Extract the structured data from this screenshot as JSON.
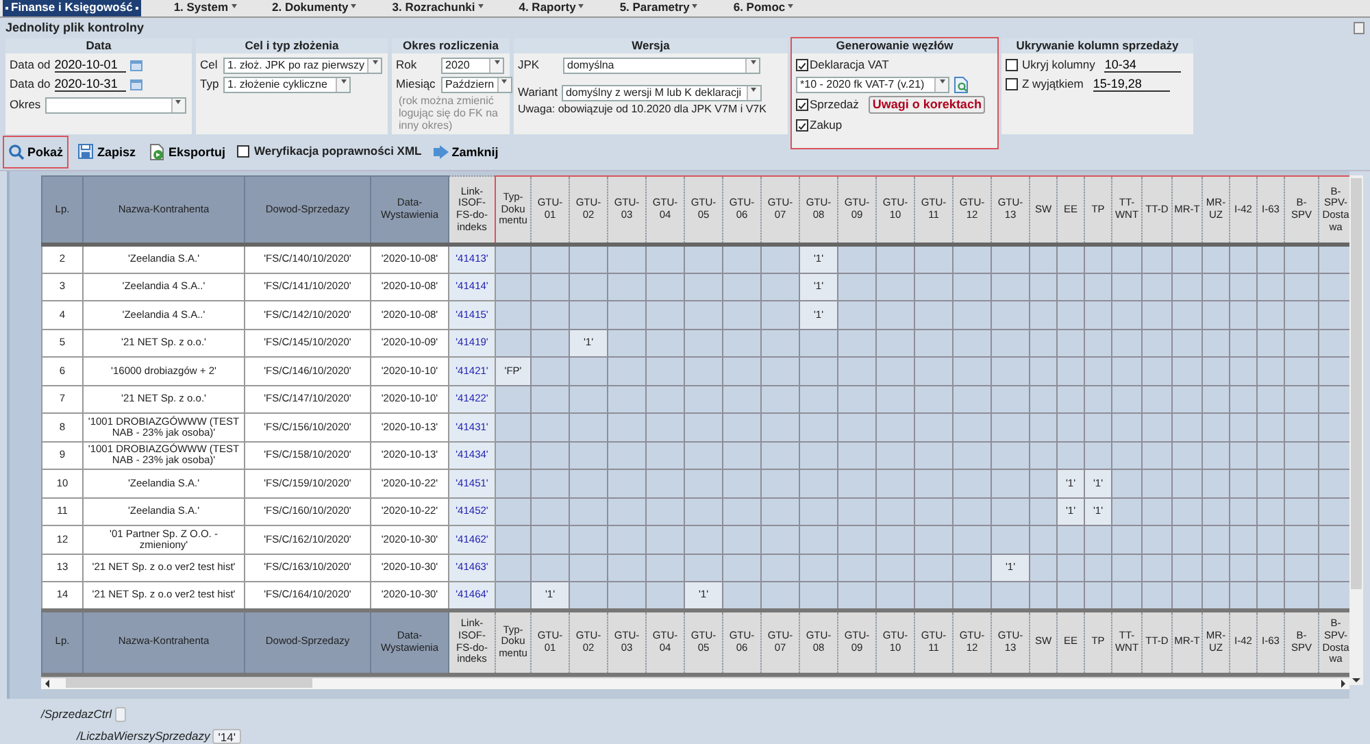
{
  "menu": [
    {
      "label": "Finanse i Księgowość",
      "selected": true
    },
    {
      "label": "1. System",
      "selected": false
    },
    {
      "label": "2. Dokumenty",
      "selected": false
    },
    {
      "label": "3. Rozrachunki",
      "selected": false
    },
    {
      "label": "4. Raporty",
      "selected": false
    },
    {
      "label": "5. Parametry",
      "selected": false
    },
    {
      "label": "6. Pomoc",
      "selected": false
    }
  ],
  "page_title": "Jednolity plik kontrolny",
  "filters": {
    "data": {
      "title": "Data",
      "date_from": {
        "label": "Data od",
        "value": "2020-10-01"
      },
      "date_to": {
        "label": "Data do",
        "value": "2020-10-31"
      },
      "period": {
        "label": "Okres"
      }
    },
    "purpose": {
      "title": "Cel i typ złożenia",
      "goal": {
        "label": "Cel",
        "value": "1. złoż. JPK po raz pierwszy"
      },
      "type": {
        "label": "Typ",
        "value": "1. złożenie cykliczne"
      }
    },
    "settlement": {
      "title": "Okres rozliczenia",
      "year": {
        "label": "Rok",
        "value": "2020"
      },
      "month": {
        "label": "Miesiąc",
        "value": "Październ"
      },
      "note": "(rok można zmienić logując się do FK na inny okres)"
    },
    "version": {
      "title": "Wersja",
      "jpk": {
        "label": "JPK",
        "value": "domyślna"
      },
      "variant": {
        "label": "Wariant",
        "value": "domyślny z wersji M lub K deklaracji"
      },
      "note": "Uwaga: obowiązuje od 10.2020 dla JPK V7M i V7K"
    },
    "nodes": {
      "title": "Generowanie węzłów",
      "highlighted": true,
      "vat": {
        "label": "Deklaracja VAT",
        "checked": true
      },
      "declaration": {
        "value": "*10 - 2020 fk VAT-7 (v.21)"
      },
      "sales": {
        "label": "Sprzedaż",
        "checked": true
      },
      "purchase": {
        "label": "Zakup",
        "checked": true
      },
      "button": "Uwagi o korektach"
    },
    "hide": {
      "title": "Ukrywanie kolumn sprzedaży",
      "hide_columns": {
        "label": "Ukryj kolumny",
        "checked": false,
        "value": "10-34"
      },
      "except": {
        "label": "Z wyjątkiem",
        "checked": false,
        "value": "15-19,28"
      }
    }
  },
  "toolbar": [
    {
      "kind": "search",
      "label": "Pokaż",
      "highlighted": true
    },
    {
      "kind": "save",
      "label": "Zapisz",
      "highlighted": false
    },
    {
      "kind": "export",
      "label": "Eksportuj",
      "highlighted": false
    },
    {
      "kind": "checkbox",
      "label": "Weryfikacja poprawności XML",
      "checked": false
    },
    {
      "kind": "close",
      "label": "Zamknij",
      "highlighted": false
    }
  ],
  "table": {
    "columns": [
      {
        "label": "Lp.",
        "kind": "main"
      },
      {
        "label": "Nazwa-Kontrahenta",
        "kind": "main"
      },
      {
        "label": "Dowod-Sprzedazy",
        "kind": "main"
      },
      {
        "label": "Data-Wystawienia",
        "kind": "main"
      },
      {
        "label": "Link-ISOF-FS-do-indeks",
        "kind": "link"
      },
      {
        "label": "Typ-Dokumentu",
        "kind": "flag"
      },
      {
        "label": "GTU-01",
        "kind": "flag"
      },
      {
        "label": "GTU-02",
        "kind": "flag"
      },
      {
        "label": "GTU-03",
        "kind": "flag"
      },
      {
        "label": "GTU-04",
        "kind": "flag"
      },
      {
        "label": "GTU-05",
        "kind": "flag"
      },
      {
        "label": "GTU-06",
        "kind": "flag"
      },
      {
        "label": "GTU-07",
        "kind": "flag"
      },
      {
        "label": "GTU-08",
        "kind": "flag"
      },
      {
        "label": "GTU-09",
        "kind": "flag"
      },
      {
        "label": "GTU-10",
        "kind": "flag"
      },
      {
        "label": "GTU-11",
        "kind": "flag"
      },
      {
        "label": "GTU-12",
        "kind": "flag"
      },
      {
        "label": "GTU-13",
        "kind": "flag"
      },
      {
        "label": "SW",
        "kind": "flag"
      },
      {
        "label": "EE",
        "kind": "flag"
      },
      {
        "label": "TP",
        "kind": "flag"
      },
      {
        "label": "TT-WNT",
        "kind": "flag"
      },
      {
        "label": "TT-D",
        "kind": "flag"
      },
      {
        "label": "MR-T",
        "kind": "flag"
      },
      {
        "label": "MR-UZ",
        "kind": "flag"
      },
      {
        "label": "I-42",
        "kind": "flag"
      },
      {
        "label": "I-63",
        "kind": "flag"
      },
      {
        "label": "B-SPV",
        "kind": "flag"
      },
      {
        "label": "B-SPV-Dostawa",
        "kind": "flag"
      }
    ],
    "flags_highlighted": true,
    "rows": [
      {
        "cells": [
          "2",
          "'Zeelandia S.A.'",
          "'FS/C/140/10/2020'",
          "'2020-10-08'",
          "'41413'",
          null,
          null,
          null,
          null,
          null,
          null,
          null,
          null,
          "'1'",
          null,
          null,
          null,
          null,
          null,
          null,
          null,
          null,
          null,
          null,
          null,
          null,
          null,
          null,
          null,
          null
        ]
      },
      {
        "cells": [
          "3",
          "'Zeelandia 4 S.A..'",
          "'FS/C/141/10/2020'",
          "'2020-10-08'",
          "'41414'",
          null,
          null,
          null,
          null,
          null,
          null,
          null,
          null,
          "'1'",
          null,
          null,
          null,
          null,
          null,
          null,
          null,
          null,
          null,
          null,
          null,
          null,
          null,
          null,
          null,
          null
        ]
      },
      {
        "cells": [
          "4",
          "'Zeelandia 4 S.A..'",
          "'FS/C/142/10/2020'",
          "'2020-10-08'",
          "'41415'",
          null,
          null,
          null,
          null,
          null,
          null,
          null,
          null,
          "'1'",
          null,
          null,
          null,
          null,
          null,
          null,
          null,
          null,
          null,
          null,
          null,
          null,
          null,
          null,
          null,
          null
        ]
      },
      {
        "cells": [
          "5",
          "'21 NET Sp. z o.o.'",
          "'FS/C/145/10/2020'",
          "'2020-10-09'",
          "'41419'",
          null,
          null,
          "'1'",
          null,
          null,
          null,
          null,
          null,
          null,
          null,
          null,
          null,
          null,
          null,
          null,
          null,
          null,
          null,
          null,
          null,
          null,
          null,
          null,
          null,
          null
        ]
      },
      {
        "cells": [
          "6",
          "'16000 drobiazgów + 2'",
          "'FS/C/146/10/2020'",
          "'2020-10-10'",
          "'41421'",
          "'FP'",
          null,
          null,
          null,
          null,
          null,
          null,
          null,
          null,
          null,
          null,
          null,
          null,
          null,
          null,
          null,
          null,
          null,
          null,
          null,
          null,
          null,
          null,
          null,
          null
        ]
      },
      {
        "cells": [
          "7",
          "'21 NET Sp. z o.o.'",
          "'FS/C/147/10/2020'",
          "'2020-10-10'",
          "'41422'",
          null,
          null,
          null,
          null,
          null,
          null,
          null,
          null,
          null,
          null,
          null,
          null,
          null,
          null,
          null,
          null,
          null,
          null,
          null,
          null,
          null,
          null,
          null,
          null,
          null
        ]
      },
      {
        "cells": [
          "8",
          "'1001 DROBIAZGÓWWW (TEST NAB - 23% jak osoba)'",
          "'FS/C/156/10/2020'",
          "'2020-10-13'",
          "'41431'",
          null,
          null,
          null,
          null,
          null,
          null,
          null,
          null,
          null,
          null,
          null,
          null,
          null,
          null,
          null,
          null,
          null,
          null,
          null,
          null,
          null,
          null,
          null,
          null,
          null
        ]
      },
      {
        "cells": [
          "9",
          "'1001 DROBIAZGÓWWW (TEST NAB - 23% jak osoba)'",
          "'FS/C/158/10/2020'",
          "'2020-10-13'",
          "'41434'",
          null,
          null,
          null,
          null,
          null,
          null,
          null,
          null,
          null,
          null,
          null,
          null,
          null,
          null,
          null,
          null,
          null,
          null,
          null,
          null,
          null,
          null,
          null,
          null,
          null
        ]
      },
      {
        "cells": [
          "10",
          "'Zeelandia S.A.'",
          "'FS/C/159/10/2020'",
          "'2020-10-22'",
          "'41451'",
          null,
          null,
          null,
          null,
          null,
          null,
          null,
          null,
          null,
          null,
          null,
          null,
          null,
          null,
          null,
          "'1'",
          "'1'",
          null,
          null,
          null,
          null,
          null,
          null,
          null,
          null
        ]
      },
      {
        "cells": [
          "11",
          "'Zeelandia S.A.'",
          "'FS/C/160/10/2020'",
          "'2020-10-22'",
          "'41452'",
          null,
          null,
          null,
          null,
          null,
          null,
          null,
          null,
          null,
          null,
          null,
          null,
          null,
          null,
          null,
          "'1'",
          "'1'",
          null,
          null,
          null,
          null,
          null,
          null,
          null,
          null
        ]
      },
      {
        "cells": [
          "12",
          "'01 Partner Sp. Z O.O. - zmieniony'",
          "'FS/C/162/10/2020'",
          "'2020-10-30'",
          "'41462'",
          null,
          null,
          null,
          null,
          null,
          null,
          null,
          null,
          null,
          null,
          null,
          null,
          null,
          null,
          null,
          null,
          null,
          null,
          null,
          null,
          null,
          null,
          null,
          null,
          null
        ]
      },
      {
        "cells": [
          "13",
          "'21 NET Sp. z o.o ver2 test hist'",
          "'FS/C/163/10/2020'",
          "'2020-10-30'",
          "'41463'",
          null,
          null,
          null,
          null,
          null,
          null,
          null,
          null,
          null,
          null,
          null,
          null,
          null,
          "'1'",
          null,
          null,
          null,
          null,
          null,
          null,
          null,
          null,
          null,
          null,
          null
        ]
      },
      {
        "cells": [
          "14",
          "'21 NET Sp. z o.o ver2 test hist'",
          "'FS/C/164/10/2020'",
          "'2020-10-30'",
          "'41464'",
          null,
          "'1'",
          null,
          null,
          null,
          "'1'",
          null,
          null,
          null,
          null,
          null,
          null,
          null,
          null,
          null,
          null,
          null,
          null,
          null,
          null,
          null,
          null,
          null,
          null,
          null
        ]
      }
    ],
    "footer_columns": [
      "Lp.",
      "Nazwa-Kontrahenta",
      "Dowod-Sprzedazy",
      "Data-Wystawienia",
      "Link-ISOF-FS-do-indeks",
      "Typ-Dokumentu",
      "GTU-01",
      "GTU-02",
      "GTU-03",
      "GTU-04",
      "GTU-05",
      "GTU-06",
      "GTU-07",
      "GTU-08",
      "GTU-09",
      "GTU-10",
      "GTU-11",
      "GTU-12",
      "GTU-13",
      "SW",
      "EE",
      "TP",
      "TT-WNT",
      "TT-D",
      "MR-T",
      "MR-UZ",
      "I-42",
      "I-63",
      "B-SPV",
      "B-SPV-Dostawa"
    ]
  },
  "xml_tree": {
    "node": "/SprzedazCtrl",
    "children": [
      {
        "node": "/LiczbaWierszySprzedazy",
        "value": "'14'"
      }
    ]
  }
}
